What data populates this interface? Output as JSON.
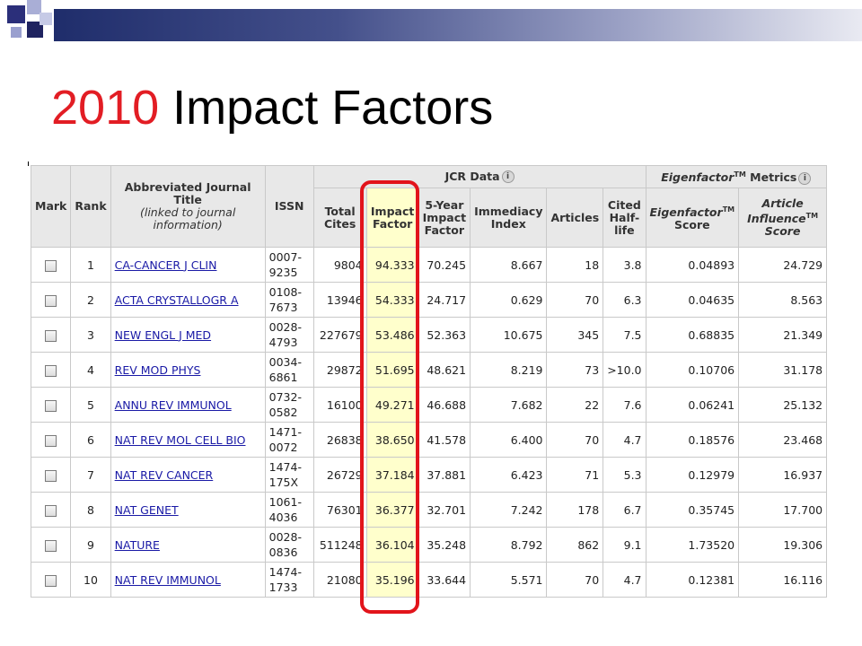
{
  "slide": {
    "title_year": "2010",
    "title_rest": " Impact Factors"
  },
  "headers": {
    "mark": "Mark",
    "rank": "Rank",
    "journal_title": "Abbreviated Journal Title",
    "journal_title_note": "(linked to journal information)",
    "issn": "ISSN",
    "jcr_group": "JCR Data",
    "eigen_group_pre": "Eigenfactor",
    "eigen_group_tm": "TM",
    "eigen_group_post": " Metrics",
    "total_cites": "Total Cites",
    "impact_factor": "Impact Factor",
    "five_year": "5-Year Impact Factor",
    "immediacy": "Immediacy Index",
    "articles": "Articles",
    "cited_half_life": "Cited Half-life",
    "eigen_score_pre": "Eigenfactor",
    "eigen_score_tm": "TM",
    "eigen_score_post": " Score",
    "article_influence_pre": "Article Influence",
    "article_influence_tm": "TM",
    "article_influence_post": " Score"
  },
  "rows": [
    {
      "rank": "1",
      "title": "CA-CANCER J CLIN",
      "issn1": "0007-",
      "issn2": "9235",
      "total_cites": "9804",
      "impact_factor": "94.333",
      "five_year": "70.245",
      "immediacy": "8.667",
      "articles": "18",
      "half_life": "3.8",
      "eigen": "0.04893",
      "influence": "24.729"
    },
    {
      "rank": "2",
      "title": "ACTA CRYSTALLOGR A",
      "issn1": "0108-",
      "issn2": "7673",
      "total_cites": "13946",
      "impact_factor": "54.333",
      "five_year": "24.717",
      "immediacy": "0.629",
      "articles": "70",
      "half_life": "6.3",
      "eigen": "0.04635",
      "influence": "8.563"
    },
    {
      "rank": "3",
      "title": "NEW ENGL J MED",
      "issn1": "0028-",
      "issn2": "4793",
      "total_cites": "227679",
      "impact_factor": "53.486",
      "five_year": "52.363",
      "immediacy": "10.675",
      "articles": "345",
      "half_life": "7.5",
      "eigen": "0.68835",
      "influence": "21.349"
    },
    {
      "rank": "4",
      "title": "REV MOD PHYS",
      "issn1": "0034-",
      "issn2": "6861",
      "total_cites": "29872",
      "impact_factor": "51.695",
      "five_year": "48.621",
      "immediacy": "8.219",
      "articles": "73",
      "half_life": ">10.0",
      "eigen": "0.10706",
      "influence": "31.178"
    },
    {
      "rank": "5",
      "title": "ANNU REV IMMUNOL",
      "issn1": "0732-",
      "issn2": "0582",
      "total_cites": "16100",
      "impact_factor": "49.271",
      "five_year": "46.688",
      "immediacy": "7.682",
      "articles": "22",
      "half_life": "7.6",
      "eigen": "0.06241",
      "influence": "25.132"
    },
    {
      "rank": "6",
      "title": "NAT REV MOL CELL BIO",
      "issn1": "1471-",
      "issn2": "0072",
      "total_cites": "26838",
      "impact_factor": "38.650",
      "five_year": "41.578",
      "immediacy": "6.400",
      "articles": "70",
      "half_life": "4.7",
      "eigen": "0.18576",
      "influence": "23.468"
    },
    {
      "rank": "7",
      "title": "NAT REV CANCER",
      "issn1": "1474-",
      "issn2": "175X",
      "total_cites": "26729",
      "impact_factor": "37.184",
      "five_year": "37.881",
      "immediacy": "6.423",
      "articles": "71",
      "half_life": "5.3",
      "eigen": "0.12979",
      "influence": "16.937"
    },
    {
      "rank": "8",
      "title": "NAT GENET",
      "issn1": "1061-",
      "issn2": "4036",
      "total_cites": "76301",
      "impact_factor": "36.377",
      "five_year": "32.701",
      "immediacy": "7.242",
      "articles": "178",
      "half_life": "6.7",
      "eigen": "0.35745",
      "influence": "17.700"
    },
    {
      "rank": "9",
      "title": "NATURE",
      "issn1": "0028-",
      "issn2": "0836",
      "total_cites": "511248",
      "impact_factor": "36.104",
      "five_year": "35.248",
      "immediacy": "8.792",
      "articles": "862",
      "half_life": "9.1",
      "eigen": "1.73520",
      "influence": "19.306"
    },
    {
      "rank": "10",
      "title": "NAT REV IMMUNOL",
      "issn1": "1474-",
      "issn2": "1733",
      "total_cites": "21080",
      "impact_factor": "35.196",
      "five_year": "33.644",
      "immediacy": "5.571",
      "articles": "70",
      "half_life": "4.7",
      "eigen": "0.12381",
      "influence": "16.116"
    }
  ]
}
